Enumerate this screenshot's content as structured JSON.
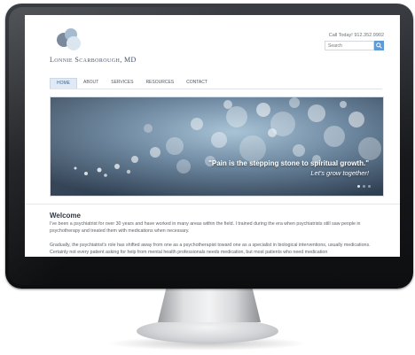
{
  "site": {
    "logo_text": "Lonnie Scarborough, MD",
    "call_text": "Call Today! 912.352.9902",
    "search_placeholder": "Search"
  },
  "nav": [
    {
      "label": "HOME",
      "active": true
    },
    {
      "label": "ABOUT",
      "active": false
    },
    {
      "label": "SERVICES",
      "active": false
    },
    {
      "label": "RESOURCES",
      "active": false
    },
    {
      "label": "CONTACT",
      "active": false
    }
  ],
  "hero": {
    "quote": "\"Pain is the stepping stone to spiritual growth.\"",
    "subtitle": "Let's grow together!"
  },
  "content": {
    "heading": "Welcome",
    "paragraph1": "I've been a psychiatrist for over 30 years and have worked in many areas within the field. I trained during the era when psychiatrists still saw people in psychotherapy and treated them with medications when necessary.",
    "paragraph2": "Gradually, the psychiatrist's role has shifted away from one as a psychotherapist toward one as a specialist in biological interventions, usually medications. Certainly not every patient asking for help from mental health professionals needs medication, but most patients who need medication"
  },
  "colors": {
    "accent": "#5d9ad8",
    "logo": "#3d4c62"
  }
}
